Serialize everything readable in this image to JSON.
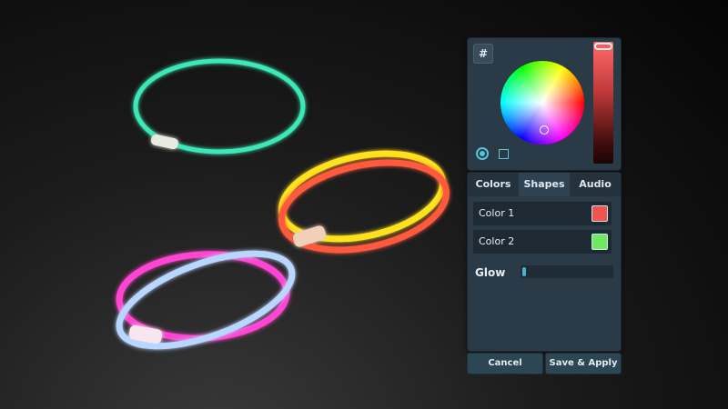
{
  "scene": {
    "objects": [
      "glow-stick-teal",
      "glow-stick-yellow",
      "glow-stick-red",
      "glow-stick-magenta",
      "glow-stick-light-blue"
    ]
  },
  "picker": {
    "hex_label": "#",
    "selected_color": "#ff5a55",
    "mode_options": [
      "circle-icon",
      "square-icon"
    ]
  },
  "settings": {
    "tabs": [
      {
        "label": "Colors"
      },
      {
        "label": "Shapes"
      },
      {
        "label": "Audio"
      }
    ],
    "active_tab": "Shapes",
    "colors": [
      {
        "label": "Color 1",
        "value": "#f0544e"
      },
      {
        "label": "Color 2",
        "value": "#6dea62"
      }
    ],
    "glow": {
      "label": "Glow",
      "value": 0.03
    }
  },
  "actions": {
    "cancel": "Cancel",
    "save": "Save & Apply"
  }
}
